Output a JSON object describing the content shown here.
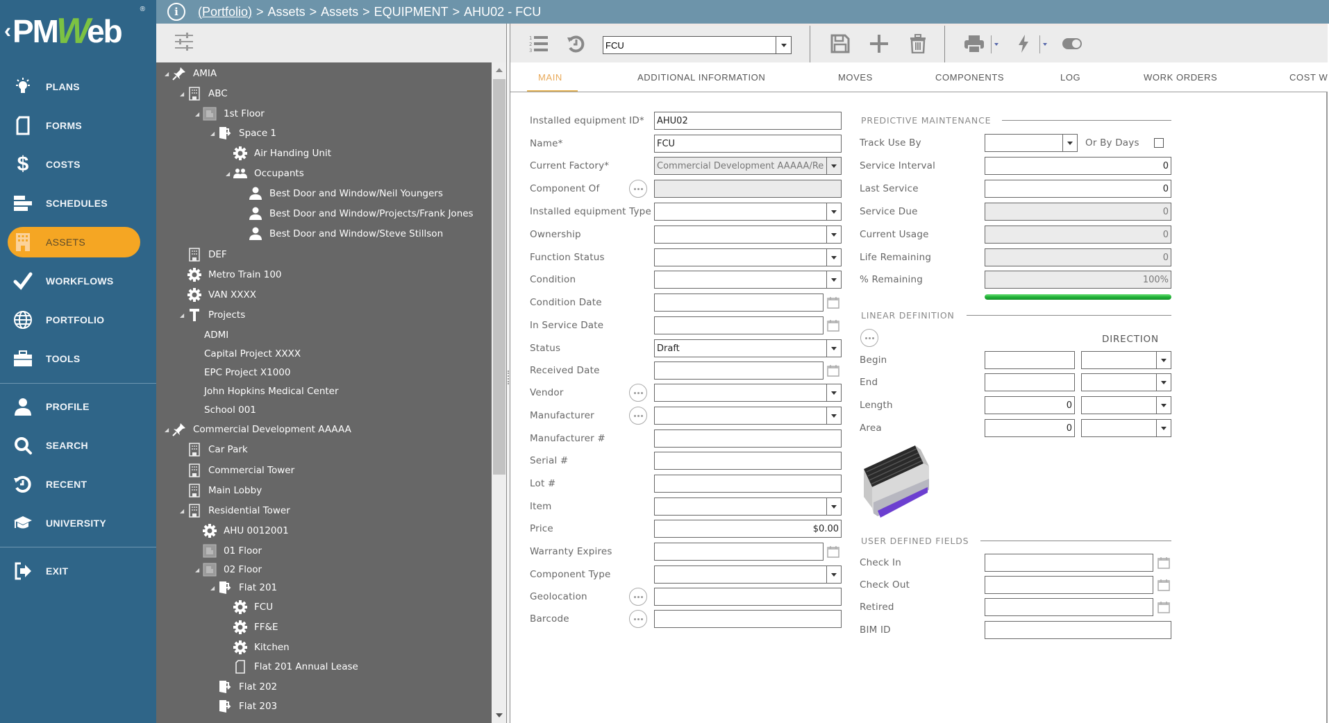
{
  "app": {
    "logo_text_left": "PM",
    "logo_text_w": "W",
    "logo_text_right": "eb",
    "logo_reg": "®",
    "brand_color": "#2f6588",
    "accent_color": "#f5a623"
  },
  "breadcrumb": {
    "root": "(Portfolio)",
    "separator": ">",
    "items": [
      "Assets",
      "Assets",
      "EQUIPMENT",
      "AHU02 - FCU"
    ]
  },
  "sidebar": {
    "items": [
      {
        "label": "PLANS",
        "icon": "lightbulb-icon"
      },
      {
        "label": "FORMS",
        "icon": "document-icon"
      },
      {
        "label": "COSTS",
        "icon": "dollar-icon"
      },
      {
        "label": "SCHEDULES",
        "icon": "gantt-bars-icon"
      },
      {
        "label": "ASSETS",
        "icon": "building-icon",
        "active": true
      },
      {
        "label": "WORKFLOWS",
        "icon": "checkmark-icon"
      },
      {
        "label": "PORTFOLIO",
        "icon": "globe-icon"
      },
      {
        "label": "TOOLS",
        "icon": "toolbox-icon"
      }
    ],
    "secondary": [
      {
        "label": "PROFILE",
        "icon": "user-icon"
      },
      {
        "label": "SEARCH",
        "icon": "search-icon"
      },
      {
        "label": "RECENT",
        "icon": "history-icon"
      },
      {
        "label": "UNIVERSITY",
        "icon": "graduation-cap-icon"
      }
    ],
    "exit": {
      "label": "EXIT",
      "icon": "exit-icon"
    }
  },
  "tree": {
    "nodes": [
      {
        "label": "AMIA",
        "icon": "pin",
        "level": 0,
        "expanded": true
      },
      {
        "label": "ABC",
        "icon": "building",
        "level": 1,
        "expanded": true
      },
      {
        "label": "1st Floor",
        "icon": "floor",
        "level": 2,
        "expanded": true
      },
      {
        "label": "Space 1",
        "icon": "space",
        "level": 3,
        "expanded": true
      },
      {
        "label": "Air Handing Unit",
        "icon": "gear",
        "level": 4
      },
      {
        "label": "Occupants",
        "icon": "group",
        "level": 4,
        "expanded": true
      },
      {
        "label": "Best Door and Window/Neil Youngers",
        "icon": "person",
        "level": 5
      },
      {
        "label": "Best Door and Window/Projects/Frank Jones",
        "icon": "person",
        "level": 5
      },
      {
        "label": "Best Door and Window/Steve Stillson",
        "icon": "person",
        "level": 5
      },
      {
        "label": "DEF",
        "icon": "building",
        "level": 1
      },
      {
        "label": "Metro Train 100",
        "icon": "gear",
        "level": 1
      },
      {
        "label": "VAN XXXX",
        "icon": "gear",
        "level": 1
      },
      {
        "label": "Projects",
        "icon": "projects",
        "level": 1,
        "expanded": true
      },
      {
        "label": "ADMI",
        "icon": "none",
        "level": 2
      },
      {
        "label": "Capital Project XXXX",
        "icon": "none",
        "level": 2
      },
      {
        "label": "EPC Project X1000",
        "icon": "none",
        "level": 2
      },
      {
        "label": "John Hopkins Medical Center",
        "icon": "none",
        "level": 2
      },
      {
        "label": "School 001",
        "icon": "none",
        "level": 2
      },
      {
        "label": "Commercial Development AAAAA",
        "icon": "pin",
        "level": 0,
        "expanded": true
      },
      {
        "label": "Car Park",
        "icon": "building",
        "level": 1
      },
      {
        "label": "Commercial Tower",
        "icon": "building",
        "level": 1
      },
      {
        "label": "Main Lobby",
        "icon": "building",
        "level": 1
      },
      {
        "label": "Residential Tower",
        "icon": "building",
        "level": 1,
        "expanded": true
      },
      {
        "label": "AHU 0012001",
        "icon": "gear",
        "level": 2
      },
      {
        "label": "01 Floor",
        "icon": "floor",
        "level": 2
      },
      {
        "label": "02 Floor",
        "icon": "floor",
        "level": 2,
        "expanded": true
      },
      {
        "label": "Flat 201",
        "icon": "space",
        "level": 3,
        "expanded": true
      },
      {
        "label": "FCU",
        "icon": "gear",
        "level": 4
      },
      {
        "label": "FF&E",
        "icon": "gear",
        "level": 4
      },
      {
        "label": "Kitchen",
        "icon": "gear",
        "level": 4
      },
      {
        "label": "Flat 201 Annual Lease",
        "icon": "doc",
        "level": 4
      },
      {
        "label": "Flat 202",
        "icon": "space",
        "level": 3
      },
      {
        "label": "Flat 203",
        "icon": "space",
        "level": 3
      }
    ]
  },
  "toolbar": {
    "record_select_value": "FCU"
  },
  "tabs": [
    {
      "label": "MAIN",
      "active": true
    },
    {
      "label": "ADDITIONAL INFORMATION"
    },
    {
      "label": "MOVES"
    },
    {
      "label": "COMPONENTS"
    },
    {
      "label": "LOG"
    },
    {
      "label": "WORK ORDERS"
    },
    {
      "label": "COST WO"
    }
  ],
  "form": {
    "left": [
      {
        "label": "Installed equipment ID*",
        "value": "AHU02",
        "type": "text"
      },
      {
        "label": "Name*",
        "value": "FCU",
        "type": "text"
      },
      {
        "label": "Current Factory*",
        "value": "Commercial Development AAAAA/Re",
        "type": "select",
        "readonly": true
      },
      {
        "label": "Component Of",
        "value": "",
        "type": "text",
        "readonly": true,
        "more": true
      },
      {
        "label": "Installed equipment Type",
        "value": "",
        "type": "select"
      },
      {
        "label": "Ownership",
        "value": "",
        "type": "select"
      },
      {
        "label": "Function Status",
        "value": "",
        "type": "select"
      },
      {
        "label": "Condition",
        "value": "",
        "type": "select"
      },
      {
        "label": "Condition Date",
        "value": "",
        "type": "date"
      },
      {
        "label": "In Service Date",
        "value": "",
        "type": "date"
      },
      {
        "label": "Status",
        "value": "Draft",
        "type": "select"
      },
      {
        "label": "Received Date",
        "value": "",
        "type": "date"
      },
      {
        "label": "Vendor",
        "value": "",
        "type": "select",
        "more": true
      },
      {
        "label": "Manufacturer",
        "value": "",
        "type": "select",
        "more": true
      },
      {
        "label": "Manufacturer #",
        "value": "",
        "type": "text"
      },
      {
        "label": "Serial #",
        "value": "",
        "type": "text"
      },
      {
        "label": "Lot #",
        "value": "",
        "type": "text"
      },
      {
        "label": "Item",
        "value": "",
        "type": "select"
      },
      {
        "label": "Price",
        "value": "$0.00",
        "type": "number"
      },
      {
        "label": "Warranty Expires",
        "value": "",
        "type": "date"
      },
      {
        "label": "Component Type",
        "value": "",
        "type": "select"
      },
      {
        "label": "Geolocation",
        "value": "",
        "type": "text",
        "more": true
      },
      {
        "label": "Barcode",
        "value": "",
        "type": "text",
        "more": true
      }
    ],
    "predictive": {
      "title": "PREDICTIVE MAINTENANCE",
      "track_use_by": {
        "label": "Track Use By",
        "value": ""
      },
      "or_by_days": {
        "label": "Or By Days",
        "checked": false
      },
      "fields": [
        {
          "label": "Service Interval",
          "value": "0",
          "readonly": false
        },
        {
          "label": "Last Service",
          "value": "0",
          "readonly": false
        },
        {
          "label": "Service Due",
          "value": "0",
          "readonly": true
        },
        {
          "label": "Current Usage",
          "value": "0",
          "readonly": true
        },
        {
          "label": "Life Remaining",
          "value": "0",
          "readonly": true
        },
        {
          "label": "% Remaining",
          "value": "100%",
          "readonly": true
        }
      ],
      "remaining_progress_pct": 100,
      "progress_color": "#1fb236"
    },
    "linear": {
      "title": "LINEAR DEFINITION",
      "direction_header": "DIRECTION",
      "rows": [
        {
          "label": "Begin",
          "value": "",
          "direction": ""
        },
        {
          "label": "End",
          "value": "",
          "direction": ""
        },
        {
          "label": "Length",
          "value": "0",
          "direction": ""
        },
        {
          "label": "Area",
          "value": "0",
          "direction": ""
        }
      ]
    },
    "udf": {
      "title": "USER DEFINED FIELDS",
      "fields": [
        {
          "label": "Check In",
          "value": "",
          "type": "date"
        },
        {
          "label": "Check Out",
          "value": "",
          "type": "date"
        },
        {
          "label": "Retired",
          "value": "",
          "type": "date"
        },
        {
          "label": "BIM ID",
          "value": "",
          "type": "text"
        }
      ]
    },
    "image_alt": "FCU equipment photo"
  }
}
